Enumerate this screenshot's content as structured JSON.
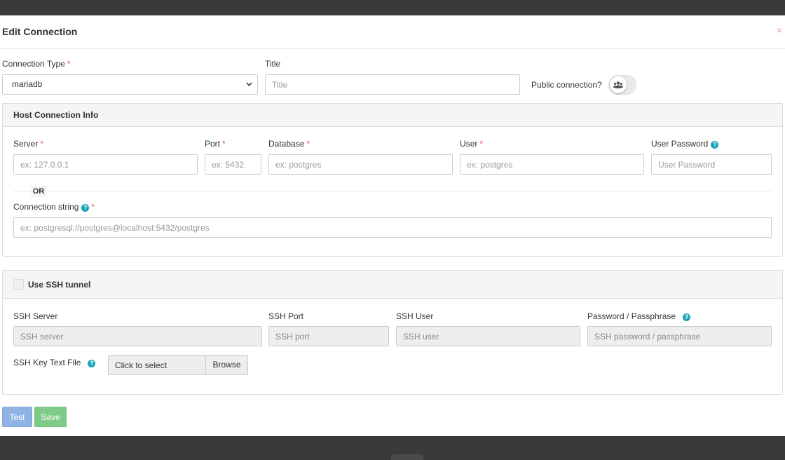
{
  "modal": {
    "title": "Edit Connection",
    "close_label": "×"
  },
  "top_row": {
    "connection_type_label": "Connection Type",
    "connection_type_value": "mariadb",
    "title_label": "Title",
    "title_placeholder": "Title",
    "public_label": "Public connection?",
    "public_enabled": false
  },
  "host_panel": {
    "title": "Host Connection Info",
    "server_label": "Server",
    "server_placeholder": "ex: 127.0.0.1",
    "port_label": "Port",
    "port_placeholder": "ex: 5432",
    "database_label": "Database",
    "database_placeholder": "ex: postgres",
    "user_label": "User",
    "user_placeholder": "ex: postgres",
    "password_label": "User Password",
    "password_placeholder": "User Password",
    "or_text": "OR",
    "conn_string_label": "Connection string",
    "conn_string_placeholder": "ex: postgresql://postgres@localhost:5432/postgres"
  },
  "ssh_panel": {
    "title": "Use SSH tunnel",
    "enabled": false,
    "server_label": "SSH Server",
    "server_placeholder": "SSH server",
    "port_label": "SSH Port",
    "port_placeholder": "SSH port",
    "user_label": "SSH User",
    "user_placeholder": "SSH user",
    "password_label": "Password / Passphrase",
    "password_placeholder": "SSH password / passphrase",
    "key_file_label": "SSH Key Text File",
    "key_file_text": "Click to select",
    "browse_label": "Browse"
  },
  "footer": {
    "test_label": "Test",
    "save_label": "Save"
  },
  "required_marker": "*",
  "help_glyph": "?",
  "colors": {
    "required": "#d9534f",
    "help": "#1aa3b8",
    "test_button": "#8fb3e3",
    "save_button": "#7ecb88"
  }
}
